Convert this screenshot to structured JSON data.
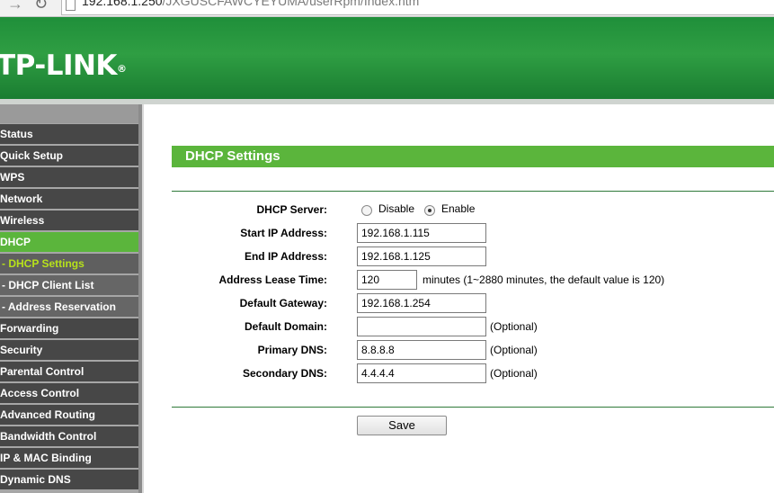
{
  "browser": {
    "url_host": "192.168.1.250",
    "url_path": "/JXGUSCFAWCYEYUMA/userRpm/Index.htm"
  },
  "header": {
    "logo_text": "TP-LINK",
    "logo_mark": "®"
  },
  "sidebar": {
    "items": [
      {
        "label": "Status",
        "sub": false,
        "active": false
      },
      {
        "label": "Quick Setup",
        "sub": false,
        "active": false
      },
      {
        "label": "WPS",
        "sub": false,
        "active": false
      },
      {
        "label": "Network",
        "sub": false,
        "active": false
      },
      {
        "label": "Wireless",
        "sub": false,
        "active": false
      },
      {
        "label": "DHCP",
        "sub": false,
        "active": true
      },
      {
        "label": "- DHCP Settings",
        "sub": true,
        "active": true
      },
      {
        "label": "- DHCP Client List",
        "sub": true,
        "active": false
      },
      {
        "label": "- Address Reservation",
        "sub": true,
        "active": false
      },
      {
        "label": "Forwarding",
        "sub": false,
        "active": false
      },
      {
        "label": "Security",
        "sub": false,
        "active": false
      },
      {
        "label": "Parental Control",
        "sub": false,
        "active": false
      },
      {
        "label": "Access Control",
        "sub": false,
        "active": false
      },
      {
        "label": "Advanced Routing",
        "sub": false,
        "active": false
      },
      {
        "label": "Bandwidth Control",
        "sub": false,
        "active": false
      },
      {
        "label": "IP & MAC Binding",
        "sub": false,
        "active": false
      },
      {
        "label": "Dynamic DNS",
        "sub": false,
        "active": false
      }
    ]
  },
  "main": {
    "section_title": "DHCP Settings",
    "dhcp_server": {
      "label": "DHCP Server:",
      "disable_label": "Disable",
      "enable_label": "Enable",
      "selected": "Enable"
    },
    "start_ip": {
      "label": "Start IP Address:",
      "value": "192.168.1.115"
    },
    "end_ip": {
      "label": "End IP Address:",
      "value": "192.168.1.125"
    },
    "lease_time": {
      "label": "Address Lease Time:",
      "value": "120",
      "hint": "minutes (1~2880 minutes, the default value is 120)"
    },
    "gateway": {
      "label": "Default Gateway:",
      "value": "192.168.1.254"
    },
    "domain": {
      "label": "Default Domain:",
      "value": "",
      "hint": "(Optional)"
    },
    "primary_dns": {
      "label": "Primary DNS:",
      "value": "8.8.8.8",
      "hint": "(Optional)"
    },
    "secondary_dns": {
      "label": "Secondary DNS:",
      "value": "4.4.4.4",
      "hint": "(Optional)"
    },
    "save_label": "Save"
  },
  "colors": {
    "brand_green": "#2f9e43",
    "accent_green": "#5bb53c",
    "menu_dark": "#474747",
    "active_sub_text": "#b7e21b"
  }
}
